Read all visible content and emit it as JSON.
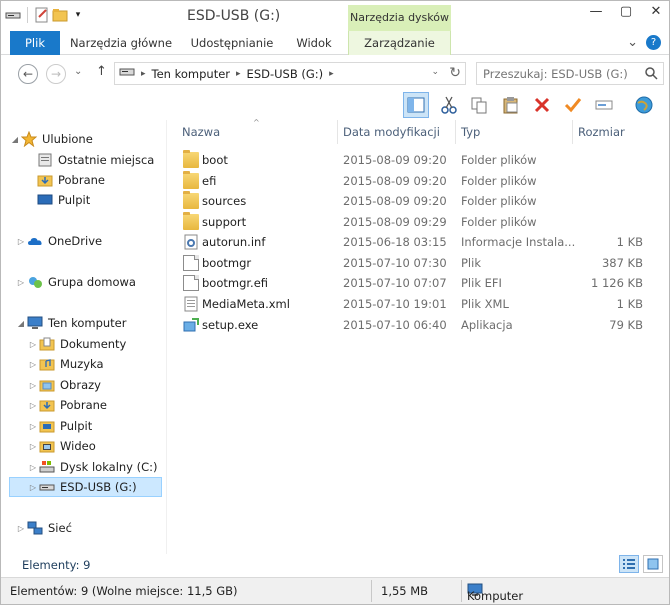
{
  "window": {
    "title": "ESD-USB (G:)",
    "context_tab_group": "Narzędzia dysków",
    "controls": {
      "minimize": "—",
      "maximize": "▢",
      "close": "✕"
    }
  },
  "ribbon": {
    "tabs": [
      "Plik",
      "Narzędzia główne",
      "Udostępnianie",
      "Widok",
      "Zarządzanie"
    ],
    "expand": "⌄",
    "help": "?"
  },
  "address": {
    "back": "←",
    "forward": "→",
    "history": "⌄",
    "up": "↑",
    "crumbs": [
      "Ten komputer",
      "ESD-USB (G:)"
    ],
    "crumb_sep": "▸",
    "dropdown": "⌄",
    "refresh": "↻",
    "search_placeholder": "Przeszukaj: ESD-USB (G:)"
  },
  "toolbar_icons": [
    "layout-icon",
    "cut-icon",
    "copy-icon",
    "paste-icon",
    "delete-icon",
    "check-icon",
    "rename-icon",
    "globe-icon"
  ],
  "nav": {
    "favorites": {
      "label": "Ulubione",
      "items": [
        "Ostatnie miejsca",
        "Pobrane",
        "Pulpit"
      ]
    },
    "onedrive": "OneDrive",
    "homegroup": "Grupa domowa",
    "computer": {
      "label": "Ten komputer",
      "items": [
        "Dokumenty",
        "Muzyka",
        "Obrazy",
        "Pobrane",
        "Pulpit",
        "Wideo",
        "Dysk lokalny (C:)",
        "ESD-USB (G:)"
      ]
    },
    "network": "Sieć",
    "expand_arrow": "▷",
    "collapse_arrow": "◢"
  },
  "columns": {
    "name": "Nazwa",
    "date": "Data modyfikacji",
    "type": "Typ",
    "size": "Rozmiar"
  },
  "sort_indicator": "^",
  "files": [
    {
      "name": "boot",
      "date": "2015-08-09 09:20",
      "type": "Folder plików",
      "size": "",
      "icon": "folder"
    },
    {
      "name": "efi",
      "date": "2015-08-09 09:20",
      "type": "Folder plików",
      "size": "",
      "icon": "folder"
    },
    {
      "name": "sources",
      "date": "2015-08-09 09:20",
      "type": "Folder plików",
      "size": "",
      "icon": "folder"
    },
    {
      "name": "support",
      "date": "2015-08-09 09:29",
      "type": "Folder plików",
      "size": "",
      "icon": "folder"
    },
    {
      "name": "autorun.inf",
      "date": "2015-06-18 03:15",
      "type": "Informacje Instala...",
      "size": "1 KB",
      "icon": "settings-file"
    },
    {
      "name": "bootmgr",
      "date": "2015-07-10 07:30",
      "type": "Plik",
      "size": "387 KB",
      "icon": "file"
    },
    {
      "name": "bootmgr.efi",
      "date": "2015-07-10 07:07",
      "type": "Plik EFI",
      "size": "1 126 KB",
      "icon": "file"
    },
    {
      "name": "MediaMeta.xml",
      "date": "2015-07-10 19:01",
      "type": "Plik XML",
      "size": "1 KB",
      "icon": "xml-file"
    },
    {
      "name": "setup.exe",
      "date": "2015-07-10 06:40",
      "type": "Aplikacja",
      "size": "79 KB",
      "icon": "app"
    }
  ],
  "count_label": "Elementy: 9",
  "status": {
    "left": "Elementów: 9 (Wolne miejsce: 11,5 GB)",
    "middle": "1,55 MB",
    "right": "Komputer"
  },
  "colors": {
    "accent": "#1979ca",
    "context_tab": "#d9efb8",
    "selection": "#cce8ff"
  }
}
